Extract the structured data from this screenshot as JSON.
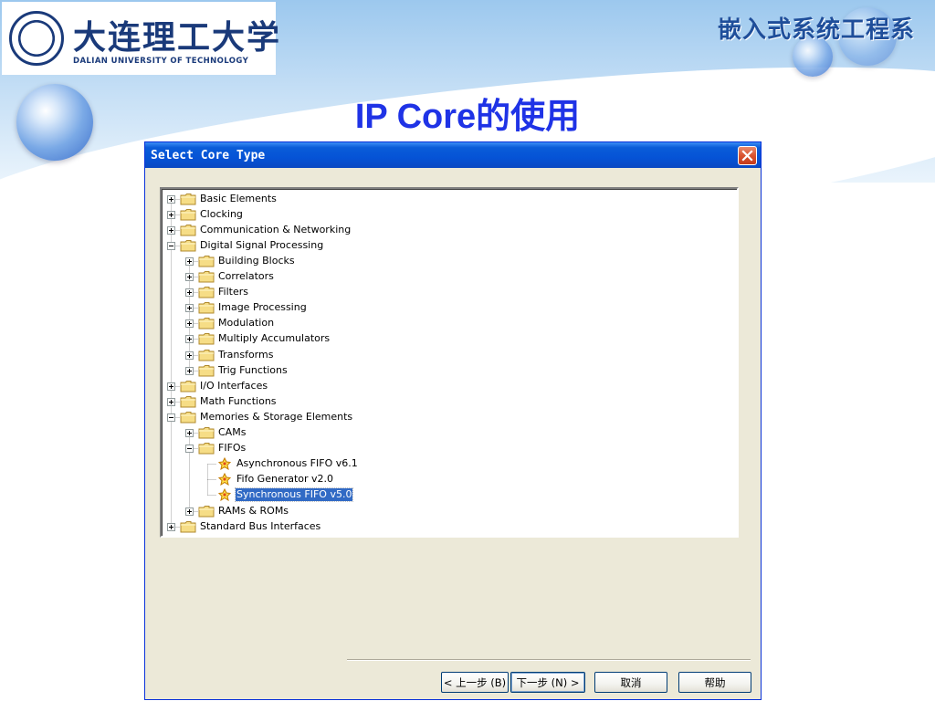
{
  "slide": {
    "logo_cn": "大连理工大学",
    "logo_en": "DALIAN UNIVERSITY OF TECHNOLOGY",
    "department": "嵌入式系统工程系",
    "title": "IP Core的使用"
  },
  "dialog": {
    "title": "Select Core Type",
    "tree": [
      {
        "label": "Basic Elements",
        "level": 0,
        "type": "folder",
        "expander": "plus"
      },
      {
        "label": "Clocking",
        "level": 0,
        "type": "folder",
        "expander": "plus"
      },
      {
        "label": "Communication & Networking",
        "level": 0,
        "type": "folder",
        "expander": "plus"
      },
      {
        "label": "Digital Signal Processing",
        "level": 0,
        "type": "folder",
        "expander": "minus"
      },
      {
        "label": "Building Blocks",
        "level": 1,
        "type": "folder",
        "expander": "plus"
      },
      {
        "label": "Correlators",
        "level": 1,
        "type": "folder",
        "expander": "plus"
      },
      {
        "label": "Filters",
        "level": 1,
        "type": "folder",
        "expander": "plus"
      },
      {
        "label": "Image Processing",
        "level": 1,
        "type": "folder",
        "expander": "plus"
      },
      {
        "label": "Modulation",
        "level": 1,
        "type": "folder",
        "expander": "plus"
      },
      {
        "label": "Multiply Accumulators",
        "level": 1,
        "type": "folder",
        "expander": "plus"
      },
      {
        "label": "Transforms",
        "level": 1,
        "type": "folder",
        "expander": "plus"
      },
      {
        "label": "Trig Functions",
        "level": 1,
        "type": "folder",
        "expander": "plus"
      },
      {
        "label": "I/O Interfaces",
        "level": 0,
        "type": "folder",
        "expander": "plus"
      },
      {
        "label": "Math Functions",
        "level": 0,
        "type": "folder",
        "expander": "plus"
      },
      {
        "label": "Memories & Storage Elements",
        "level": 0,
        "type": "folder",
        "expander": "minus"
      },
      {
        "label": "CAMs",
        "level": 1,
        "type": "folder",
        "expander": "plus"
      },
      {
        "label": "FIFOs",
        "level": 1,
        "type": "folder",
        "expander": "minus"
      },
      {
        "label": "Asynchronous FIFO v6.1",
        "level": 2,
        "type": "core",
        "expander": "none"
      },
      {
        "label": "Fifo Generator v2.0",
        "level": 2,
        "type": "core",
        "expander": "none"
      },
      {
        "label": "Synchronous FIFO v5.0",
        "level": 2,
        "type": "core",
        "expander": "none",
        "selected": true
      },
      {
        "label": "RAMs & ROMs",
        "level": 1,
        "type": "folder",
        "expander": "plus"
      },
      {
        "label": "Standard Bus Interfaces",
        "level": 0,
        "type": "folder",
        "expander": "plus"
      }
    ],
    "buttons": {
      "back": "< 上一步 (B)",
      "next": "下一步 (N) >",
      "cancel": "取消",
      "help": "帮助"
    }
  },
  "colors": {
    "title_blue": "#1f33e6",
    "xp_titlebar": "#0553d6",
    "dialog_face": "#ece9d8",
    "selection": "#316ac5"
  },
  "icons": {
    "folder": "folder-icon",
    "core": "ip-core-icon",
    "close": "close-icon"
  }
}
